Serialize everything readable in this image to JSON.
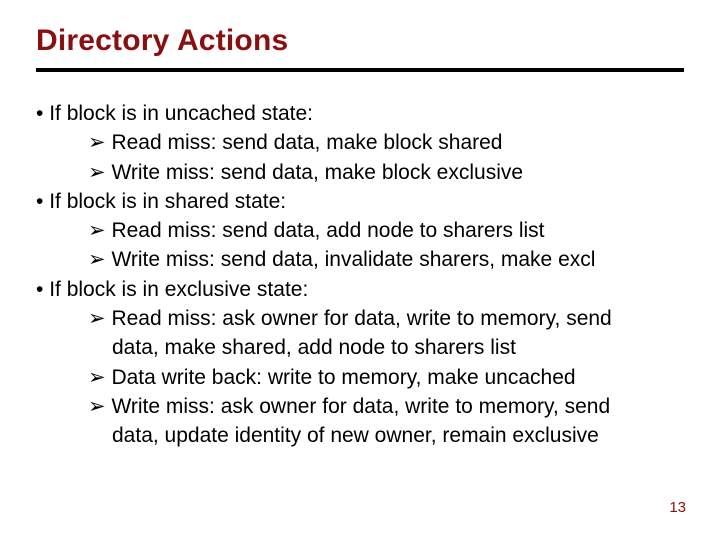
{
  "title": "Directory Actions",
  "page_number": "13",
  "lines": {
    "l1": "If block is in uncached state:",
    "l2": "Read miss: send data, make block shared",
    "l3": "Write miss: send data, make block exclusive",
    "l4": "If block is in shared state:",
    "l5": "Read miss: send data, add node to sharers list",
    "l6": "Write miss: send data, invalidate sharers, make excl",
    "l7": "If block is in exclusive state:",
    "l8": "Read miss: ask owner for data, write to memory, send",
    "l8b": "data, make shared, add node to sharers list",
    "l9": "Data write back: write to memory, make uncached",
    "l10": "Write miss: ask owner for data, write to memory, send",
    "l10b": "data, update identity of new owner, remain exclusive"
  }
}
